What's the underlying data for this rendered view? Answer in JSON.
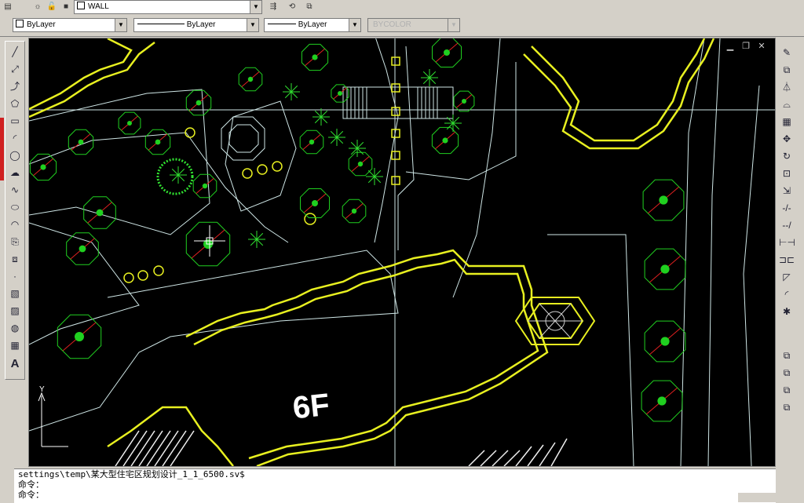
{
  "toolbar": {
    "layer_name": "WALL",
    "color_combo": "ByLayer",
    "linetype_combo": "ByLayer",
    "lineweight_combo": "ByLayer",
    "plotstyle_combo": "BYCOLOR"
  },
  "canvas": {
    "building_label": "6F",
    "ucs_y_label": "Y",
    "colors": {
      "background": "#000000",
      "walls": "#e8f020",
      "outline": "#f0f020",
      "trees_green": "#20d020",
      "trees_red": "#e02020",
      "paths": "#d0e8e8",
      "crosshair": "#ffffff"
    }
  },
  "command": {
    "history_line": "settings\\temp\\某大型住宅区规划设计_1_1_6500.sv$",
    "prompt_line_1": "命令：",
    "prompt_line_2": "命令："
  },
  "left_toolbar": [
    "line-icon",
    "construction-line-icon",
    "polyline-icon",
    "polygon-icon",
    "rectangle-icon",
    "arc-icon",
    "circle-icon",
    "revision-cloud-icon",
    "spline-icon",
    "ellipse-icon",
    "ellipse-arc-icon",
    "insert-block-icon",
    "make-block-icon",
    "point-icon",
    "hatch-icon",
    "gradient-icon",
    "region-icon",
    "table-icon",
    "multiline-text-icon"
  ],
  "right_toolbar": [
    "erase-icon",
    "copy-icon",
    "mirror-icon",
    "offset-icon",
    "array-icon",
    "move-icon",
    "rotate-icon",
    "scale-icon",
    "stretch-icon",
    "trim-icon",
    "extend-icon",
    "break-icon",
    "join-icon",
    "chamfer-icon",
    "fillet-icon",
    "explode-icon"
  ]
}
